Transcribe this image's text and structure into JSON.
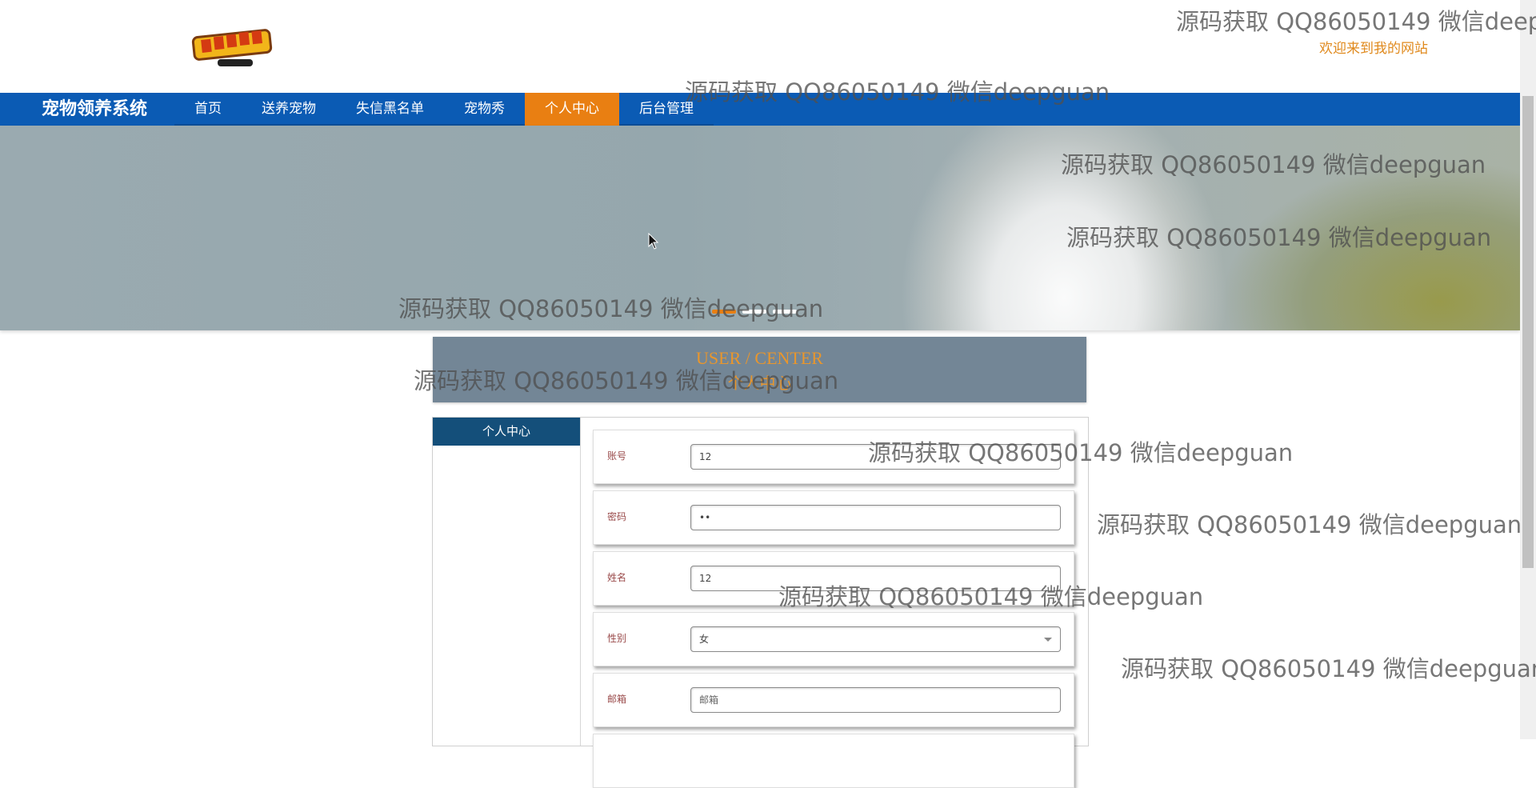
{
  "header": {
    "welcome": "欢迎来到我的网站"
  },
  "nav": {
    "brand": "宠物领养系统",
    "items": [
      {
        "label": "首页"
      },
      {
        "label": "送养宠物"
      },
      {
        "label": "失信黑名单"
      },
      {
        "label": "宠物秀"
      },
      {
        "label": "个人中心",
        "active": true
      },
      {
        "label": "后台管理"
      }
    ]
  },
  "banner": {
    "slides": 3,
    "active_slide": 1
  },
  "section": {
    "title_en": "USER / CENTER",
    "title_cn": "个人中心"
  },
  "sidebar": {
    "items": [
      {
        "label": "个人中心"
      }
    ]
  },
  "form": {
    "fields": [
      {
        "label": "账号",
        "value": "12",
        "type": "text"
      },
      {
        "label": "密码",
        "value": "••",
        "type": "password"
      },
      {
        "label": "姓名",
        "value": "12",
        "type": "text"
      },
      {
        "label": "性别",
        "value": "女",
        "type": "select"
      },
      {
        "label": "邮箱",
        "value": "",
        "placeholder": "邮箱",
        "type": "text"
      }
    ]
  },
  "watermark": {
    "text": "源码获取 QQ86050149 微信deepguan"
  },
  "colors": {
    "nav_bg": "#0b5bb4",
    "nav_active": "#e97f12",
    "section_bg": "#738696",
    "accent": "#e9962c",
    "side_tab": "#144f7a"
  }
}
